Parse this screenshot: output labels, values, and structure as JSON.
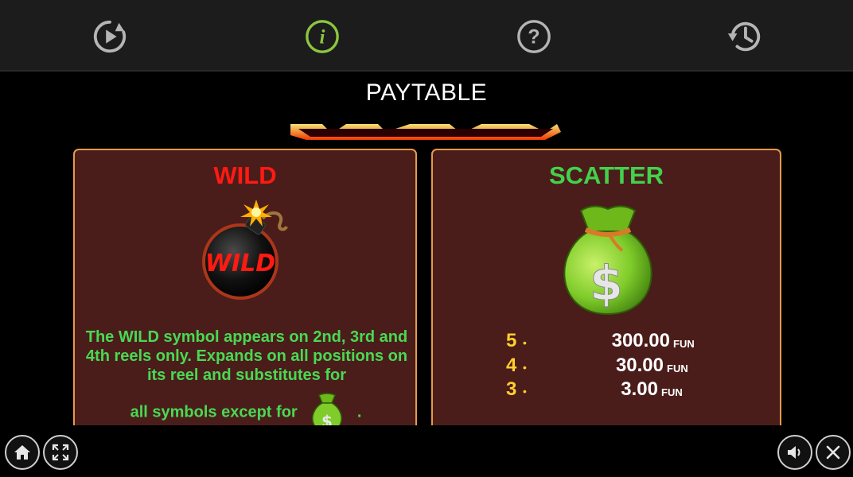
{
  "header": {
    "title": "PAYTABLE"
  },
  "toolbar": {
    "items": [
      {
        "icon": "autoplay-icon",
        "active": false
      },
      {
        "icon": "info-icon",
        "active": true
      },
      {
        "icon": "help-icon",
        "active": false
      },
      {
        "icon": "history-icon",
        "active": false
      }
    ],
    "active_color": "#8cc63f",
    "inactive_color": "#b5b5b5"
  },
  "wild_panel": {
    "title": "WILD",
    "symbol_text": "WILD",
    "description": "The WILD symbol appears on 2nd, 3rd and 4th reels only. Expands on all positions on its reel and substitutes for",
    "description_end_prefix": "all symbols except for",
    "description_end_suffix": "."
  },
  "scatter_panel": {
    "title": "SCATTER",
    "symbol_icon": "money-bag-icon",
    "payouts": [
      {
        "count": "5",
        "amount": "300.00",
        "currency": "FUN"
      },
      {
        "count": "4",
        "amount": "30.00",
        "currency": "FUN"
      },
      {
        "count": "3",
        "amount": "3.00",
        "currency": "FUN"
      }
    ]
  },
  "bottom": {
    "left_buttons": [
      "home-icon",
      "fullscreen-icon"
    ],
    "right_buttons": [
      "sound-icon",
      "close-icon"
    ]
  },
  "colors": {
    "panel_bg": "#4a1d1b",
    "panel_border": "#e59a4a",
    "wild_red": "#ff1a12",
    "scatter_green": "#43d14c",
    "payout_count": "#ffcf2e"
  }
}
